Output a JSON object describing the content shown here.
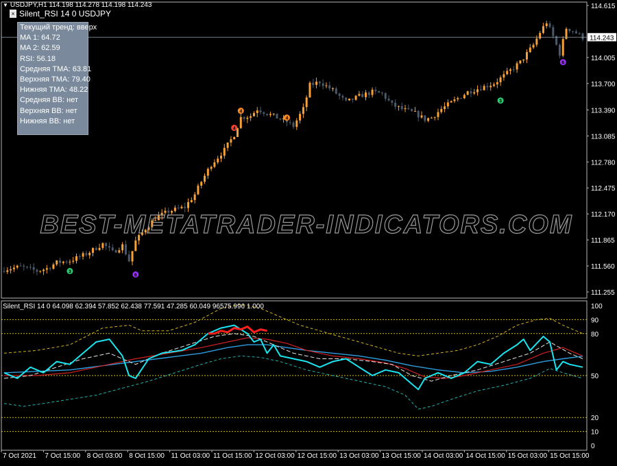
{
  "main_header": {
    "text": "USDJPY,H1  114.198 114.278 114.198 114.243"
  },
  "indicator_title": "Silent_RSI 14 0 USDJPY",
  "info_panel": [
    "Текущий тренд: вверх",
    "MA 1: 64.72",
    "MA 2: 62.59",
    "RSI: 56.18",
    "Средняя TMA: 63.81",
    "Верхняя TMA: 79.40",
    "Нижняя TMA: 48.22",
    "Средняя BB: нет",
    "Верхняя BB: нет",
    "Нижняя BB: нет"
  ],
  "watermark": "BEST-METATRADER-INDICATORS.COM",
  "subwindow_header": "Silent_RSI 14 0 64.098 62.394 57.852 62.438 77.591 47.285 60.049 96575.996 1.000",
  "colors": {
    "background": "#000000",
    "grid_border": "#b8b8b8",
    "bull_candle": "#f7a136",
    "bear_candle": "#4a5a6a",
    "rsi_line": "#19e6f0",
    "ma_fast": "#e8e8e8",
    "ma_slow": "#d42020",
    "tma_mid": "#2d9fe0",
    "tma_upper": "#d6b21f",
    "tma_lower": "#1fb5b0",
    "level_line": "#d6c21a",
    "watermark": "#9a9a9a"
  },
  "chart_data": [
    {
      "type": "candlestick",
      "symbol": "USDJPY",
      "timeframe": "H1",
      "current_price": 114.243,
      "current_price_label": "114.243",
      "ylim": [
        111.255,
        114.615
      ],
      "price_axis_labels": [
        "114.615",
        "114.005",
        "113.700",
        "113.390",
        "113.085",
        "112.780",
        "112.475",
        "112.170",
        "111.865",
        "111.560",
        "111.255"
      ],
      "x_labels": [
        "7 Oct 2021",
        "7 Oct 15:00",
        "8 Oct 03:00",
        "8 Oct 15:00",
        "11 Oct 03:00",
        "11 Oct 15:00",
        "12 Oct 03:00",
        "12 Oct 15:00",
        "13 Oct 03:00",
        "13 Oct 15:00",
        "14 Oct 03:00",
        "14 Oct 15:00",
        "15 Oct 03:00",
        "15 Oct 15:00"
      ],
      "close_path": [
        [
          0,
          111.52
        ],
        [
          5,
          111.55
        ],
        [
          10,
          111.5
        ],
        [
          13,
          111.53
        ],
        [
          16,
          111.6
        ],
        [
          20,
          111.62
        ],
        [
          25,
          111.7
        ],
        [
          30,
          111.82
        ],
        [
          33,
          111.72
        ],
        [
          36,
          111.8
        ],
        [
          38,
          111.62
        ],
        [
          40,
          111.85
        ],
        [
          43,
          112.0
        ],
        [
          46,
          112.12
        ],
        [
          50,
          112.2
        ],
        [
          55,
          112.25
        ],
        [
          58,
          112.4
        ],
        [
          60,
          112.55
        ],
        [
          63,
          112.75
        ],
        [
          67,
          112.92
        ],
        [
          70,
          113.1
        ],
        [
          72,
          113.3
        ],
        [
          75,
          113.32
        ],
        [
          77,
          113.4
        ],
        [
          80,
          113.35
        ],
        [
          83,
          113.3
        ],
        [
          86,
          113.25
        ],
        [
          88,
          113.2
        ],
        [
          91,
          113.4
        ],
        [
          93,
          113.68
        ],
        [
          96,
          113.72
        ],
        [
          100,
          113.62
        ],
        [
          104,
          113.48
        ],
        [
          108,
          113.55
        ],
        [
          112,
          113.6
        ],
        [
          115,
          113.58
        ],
        [
          118,
          113.45
        ],
        [
          121,
          113.4
        ],
        [
          125,
          113.35
        ],
        [
          128,
          113.28
        ],
        [
          130,
          113.3
        ],
        [
          133,
          113.4
        ],
        [
          137,
          113.5
        ],
        [
          141,
          113.6
        ],
        [
          145,
          113.65
        ],
        [
          149,
          113.7
        ],
        [
          153,
          113.82
        ],
        [
          157,
          113.95
        ],
        [
          161,
          114.15
        ],
        [
          163,
          114.3
        ],
        [
          165,
          114.42
        ],
        [
          167,
          114.25
        ],
        [
          169,
          114.05
        ],
        [
          171,
          114.35
        ],
        [
          173,
          114.32
        ],
        [
          176,
          114.24
        ]
      ],
      "markers": [
        {
          "bar": 20,
          "label": "3",
          "color": "#2ecc71",
          "price": 111.5
        },
        {
          "bar": 40,
          "label": "6",
          "color": "#9b30ff",
          "price": 111.46
        },
        {
          "bar": 70,
          "label": "4",
          "color": "#ff4030",
          "price": 113.18
        },
        {
          "bar": 72,
          "label": "4",
          "color": "#ff8c20",
          "price": 113.38
        },
        {
          "bar": 86,
          "label": "4",
          "color": "#ff8c20",
          "price": 113.3
        },
        {
          "bar": 151,
          "label": "3",
          "color": "#2ecc71",
          "price": 113.5
        },
        {
          "bar": 170,
          "label": "6",
          "color": "#9b30ff",
          "price": 113.95
        }
      ]
    },
    {
      "type": "line",
      "name": "Silent_RSI 14 0",
      "ylim": [
        0,
        100
      ],
      "y_axis_labels": [
        "100",
        "90",
        "80",
        "50",
        "20",
        "10",
        "0"
      ],
      "levels": [
        90,
        80,
        50,
        20,
        10
      ],
      "series": [
        {
          "key": "tma_upper",
          "points": [
            [
              0,
              66
            ],
            [
              10,
              68
            ],
            [
              20,
              72
            ],
            [
              30,
              84
            ],
            [
              38,
              86
            ],
            [
              42,
              82
            ],
            [
              50,
              82
            ],
            [
              58,
              88
            ],
            [
              66,
              98
            ],
            [
              72,
              101
            ],
            [
              78,
              98
            ],
            [
              84,
              92
            ],
            [
              90,
              86
            ],
            [
              96,
              82
            ],
            [
              102,
              78
            ],
            [
              108,
              74
            ],
            [
              114,
              70
            ],
            [
              120,
              66
            ],
            [
              126,
              64
            ],
            [
              132,
              66
            ],
            [
              138,
              68
            ],
            [
              144,
              72
            ],
            [
              150,
              78
            ],
            [
              156,
              86
            ],
            [
              162,
              90
            ],
            [
              166,
              91
            ],
            [
              170,
              86
            ],
            [
              176,
              80
            ]
          ]
        },
        {
          "key": "tma_mid",
          "points": [
            [
              0,
              52
            ],
            [
              10,
              53
            ],
            [
              20,
              54
            ],
            [
              30,
              57
            ],
            [
              40,
              60
            ],
            [
              50,
              63
            ],
            [
              60,
              66
            ],
            [
              68,
              70
            ],
            [
              74,
              72
            ],
            [
              80,
              72
            ],
            [
              86,
              70
            ],
            [
              92,
              68
            ],
            [
              100,
              66
            ],
            [
              108,
              64
            ],
            [
              116,
              61
            ],
            [
              124,
              57
            ],
            [
              132,
              54
            ],
            [
              140,
              52
            ],
            [
              148,
              53
            ],
            [
              156,
              56
            ],
            [
              164,
              60
            ],
            [
              170,
              62
            ],
            [
              176,
              63.8
            ]
          ]
        },
        {
          "key": "tma_lower",
          "points": [
            [
              0,
              30
            ],
            [
              6,
              28
            ],
            [
              12,
              30
            ],
            [
              20,
              33
            ],
            [
              28,
              36
            ],
            [
              36,
              41
            ],
            [
              44,
              46
            ],
            [
              52,
              52
            ],
            [
              60,
              58
            ],
            [
              66,
              62
            ],
            [
              72,
              64
            ],
            [
              78,
              63
            ],
            [
              84,
              60
            ],
            [
              92,
              54
            ],
            [
              100,
              50
            ],
            [
              108,
              46
            ],
            [
              116,
              42
            ],
            [
              122,
              36
            ],
            [
              126,
              26
            ],
            [
              130,
              28
            ],
            [
              136,
              33
            ],
            [
              144,
              39
            ],
            [
              152,
              43
            ],
            [
              160,
              48
            ],
            [
              166,
              55
            ],
            [
              170,
              52
            ],
            [
              176,
              48
            ]
          ]
        },
        {
          "key": "ma_slow",
          "points": [
            [
              0,
              50
            ],
            [
              10,
              50
            ],
            [
              20,
              52
            ],
            [
              30,
              57
            ],
            [
              40,
              62
            ],
            [
              50,
              66
            ],
            [
              60,
              70
            ],
            [
              68,
              74
            ],
            [
              74,
              77
            ],
            [
              80,
              76
            ],
            [
              86,
              73
            ],
            [
              92,
              68
            ],
            [
              100,
              64
            ],
            [
              108,
              62
            ],
            [
              116,
              59
            ],
            [
              122,
              55
            ],
            [
              128,
              49
            ],
            [
              134,
              48
            ],
            [
              140,
              50
            ],
            [
              148,
              54
            ],
            [
              156,
              58
            ],
            [
              164,
              66
            ],
            [
              170,
              70
            ],
            [
              176,
              64
            ]
          ]
        },
        {
          "key": "ma_fast",
          "points": [
            [
              0,
              48
            ],
            [
              8,
              50
            ],
            [
              16,
              56
            ],
            [
              24,
              62
            ],
            [
              32,
              66
            ],
            [
              40,
              58
            ],
            [
              48,
              66
            ],
            [
              56,
              72
            ],
            [
              64,
              78
            ],
            [
              70,
              80
            ],
            [
              76,
              78
            ],
            [
              82,
              72
            ],
            [
              88,
              66
            ],
            [
              96,
              62
            ],
            [
              104,
              62
            ],
            [
              112,
              60
            ],
            [
              118,
              58
            ],
            [
              124,
              50
            ],
            [
              130,
              46
            ],
            [
              136,
              50
            ],
            [
              144,
              54
            ],
            [
              152,
              60
            ],
            [
              160,
              66
            ],
            [
              166,
              74
            ],
            [
              172,
              66
            ],
            [
              176,
              62
            ]
          ]
        },
        {
          "key": "rsi",
          "points": [
            [
              0,
              52
            ],
            [
              4,
              48
            ],
            [
              8,
              56
            ],
            [
              12,
              52
            ],
            [
              16,
              60
            ],
            [
              20,
              58
            ],
            [
              24,
              66
            ],
            [
              28,
              74
            ],
            [
              32,
              76
            ],
            [
              36,
              64
            ],
            [
              38,
              50
            ],
            [
              40,
              48
            ],
            [
              44,
              62
            ],
            [
              48,
              66
            ],
            [
              54,
              68
            ],
            [
              58,
              72
            ],
            [
              62,
              80
            ],
            [
              66,
              84
            ],
            [
              70,
              86
            ],
            [
              74,
              80
            ],
            [
              76,
              74
            ],
            [
              78,
              76
            ],
            [
              80,
              66
            ],
            [
              82,
              72
            ],
            [
              84,
              64
            ],
            [
              88,
              62
            ],
            [
              92,
              60
            ],
            [
              96,
              56
            ],
            [
              100,
              60
            ],
            [
              104,
              62
            ],
            [
              108,
              56
            ],
            [
              112,
              50
            ],
            [
              116,
              54
            ],
            [
              120,
              52
            ],
            [
              124,
              44
            ],
            [
              126,
              40
            ],
            [
              128,
              48
            ],
            [
              132,
              52
            ],
            [
              136,
              48
            ],
            [
              140,
              52
            ],
            [
              144,
              60
            ],
            [
              148,
              58
            ],
            [
              152,
              66
            ],
            [
              156,
              72
            ],
            [
              158,
              76
            ],
            [
              160,
              68
            ],
            [
              164,
              78
            ],
            [
              166,
              74
            ],
            [
              168,
              54
            ],
            [
              170,
              60
            ],
            [
              172,
              58
            ],
            [
              176,
              56
            ]
          ]
        },
        {
          "key": "rsi_overbought",
          "points": [
            [
              62,
              80
            ],
            [
              64,
              80
            ],
            [
              66,
              82
            ],
            [
              68,
              81
            ],
            [
              70,
              84
            ],
            [
              72,
              83
            ],
            [
              74,
              85
            ],
            [
              76,
              81
            ],
            [
              78,
              83
            ],
            [
              80,
              82
            ]
          ]
        }
      ]
    }
  ]
}
